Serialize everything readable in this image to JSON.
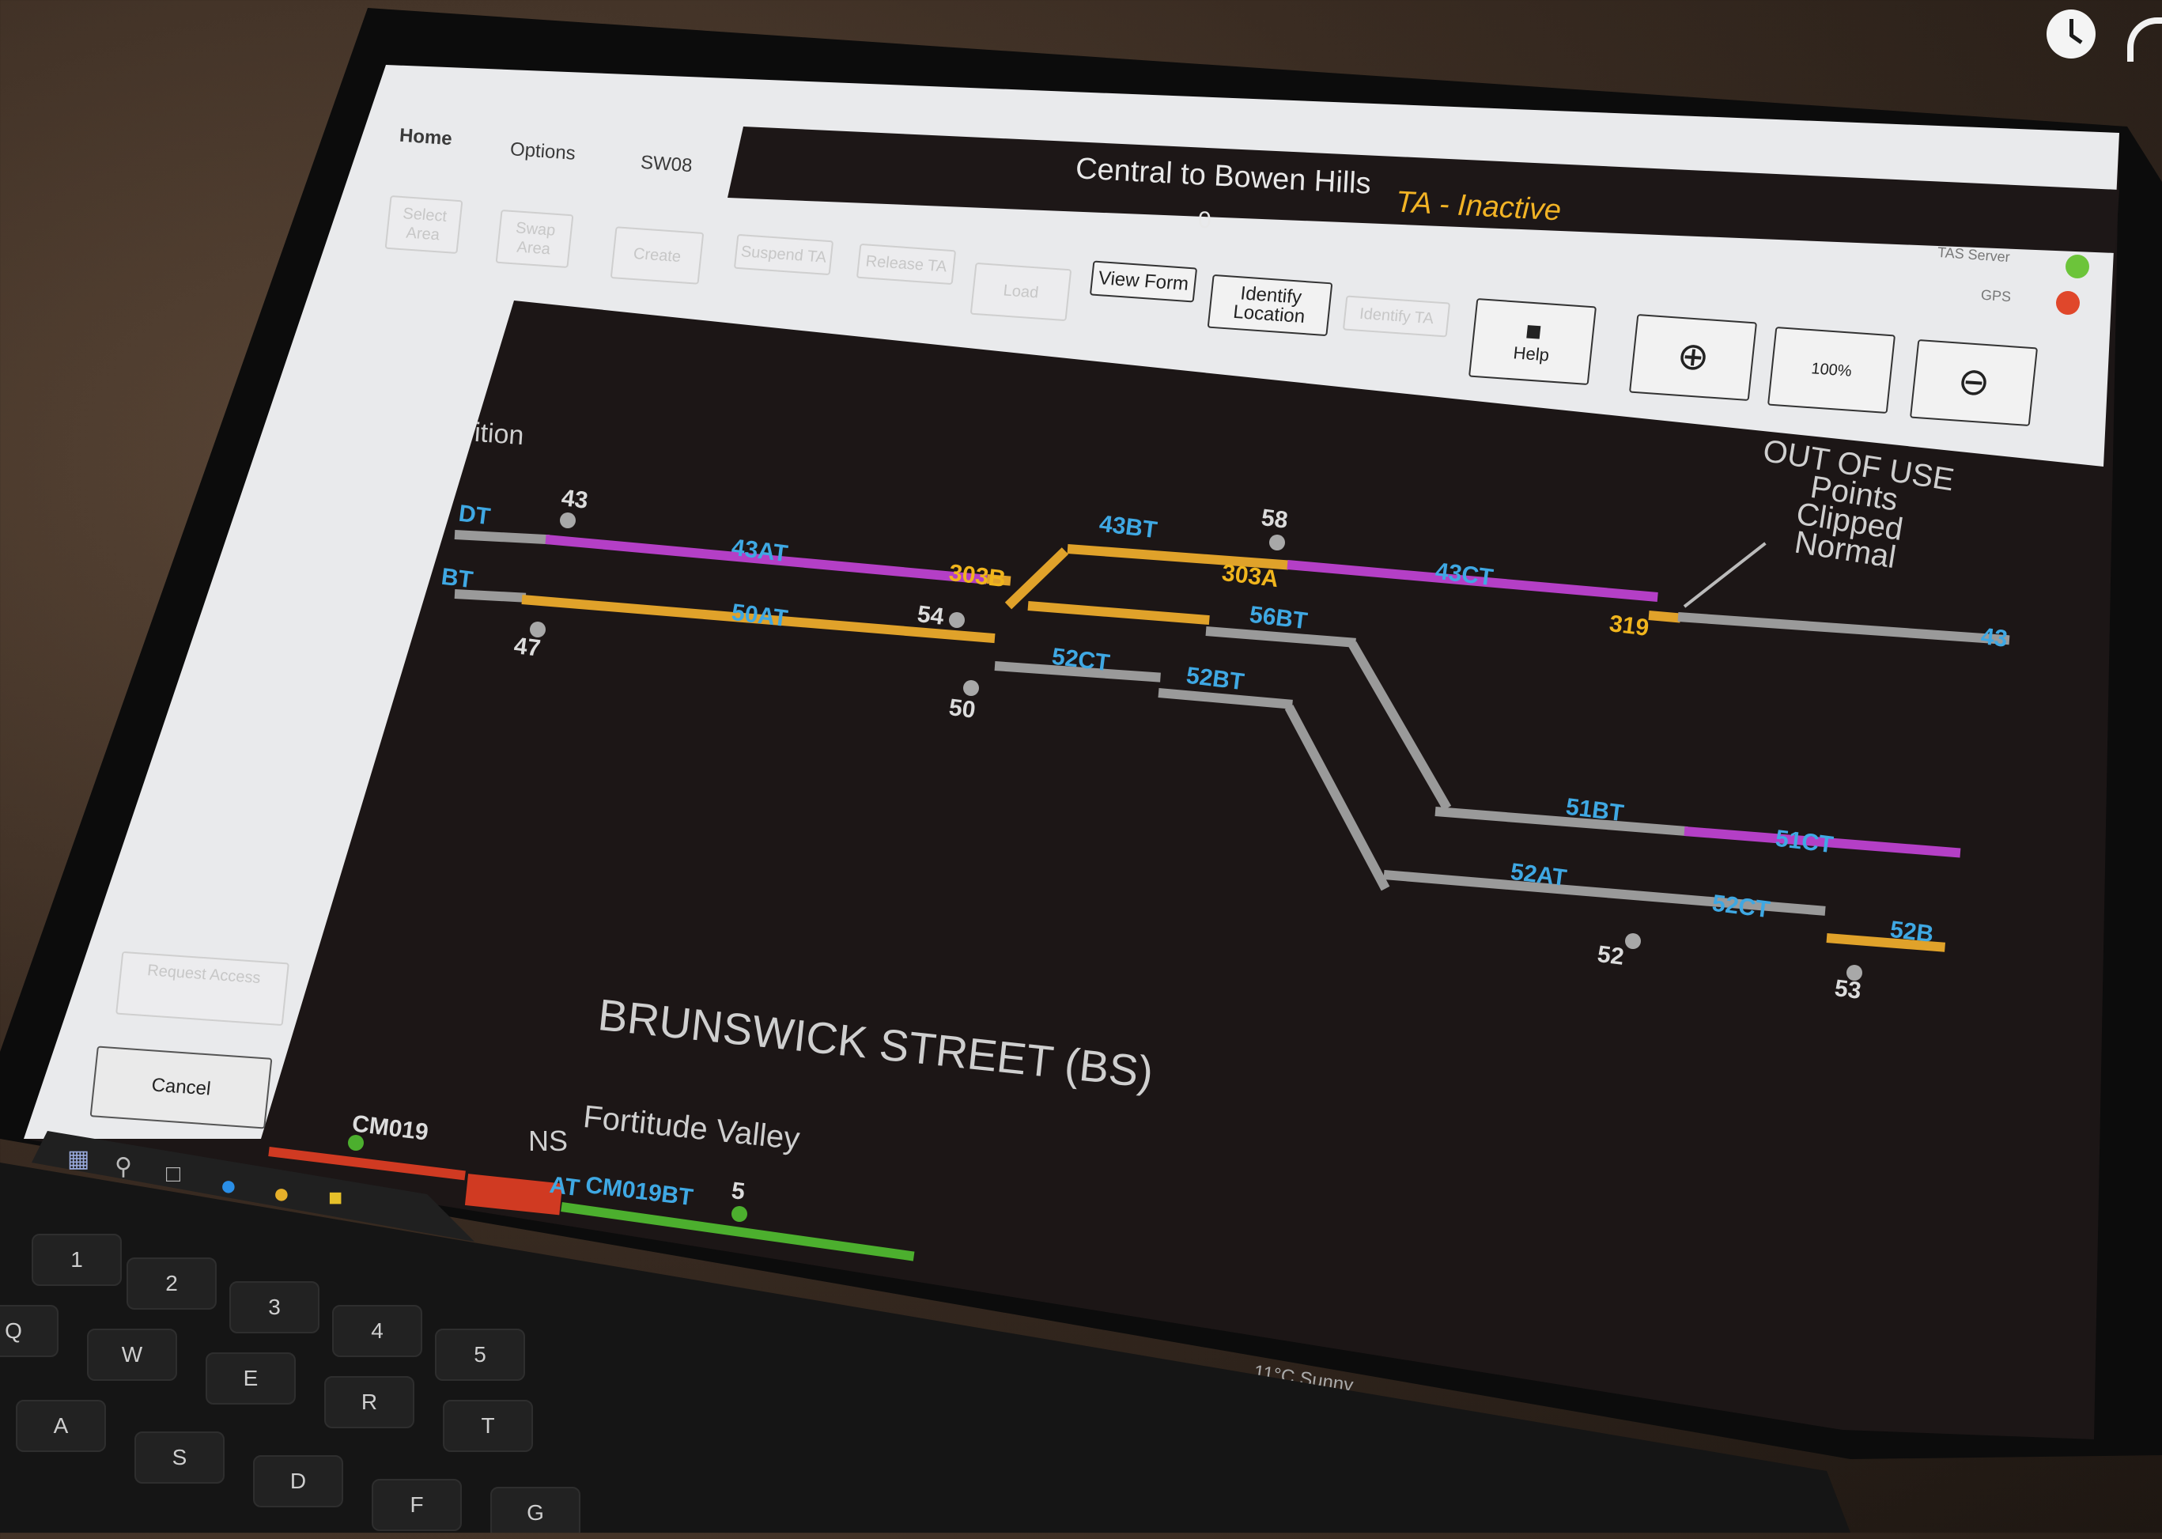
{
  "app": {
    "tabs": [
      "Home",
      "Options",
      "SW08"
    ],
    "title": "Central to Bowen Hills",
    "subtitle": "0",
    "status": "TA - Inactive",
    "indicators": [
      {
        "label": "TAS Server",
        "color": "#6cc43a"
      },
      {
        "label": "GPS",
        "color": "#e0472b"
      }
    ]
  },
  "toolbar": {
    "select_area": "Select Area",
    "swap_area": "Swap Area",
    "create": "Create",
    "suspend_ta": "Suspend TA",
    "release_ta": "Release TA",
    "load": "Load",
    "view_form": "View Form",
    "identify_location": "Identify Location",
    "identify_ta": "Identify TA",
    "help": "Help",
    "zoom_level": "100%"
  },
  "side_panel": {
    "request_access": "Request Access",
    "cancel": "Cancel",
    "partial_label": "ition"
  },
  "diagram": {
    "track_labels_cyan": [
      "43AT",
      "50AT",
      "43BT",
      "56BT",
      "43CT",
      "52CT",
      "52BT",
      "51BT",
      "51CT",
      "52AT",
      "52CT",
      "52B",
      "CM019BT"
    ],
    "track_labels_yellow": [
      "303B",
      "303A",
      "319"
    ],
    "signal_labels": [
      "43",
      "47",
      "54",
      "50",
      "58",
      "52",
      "53",
      "5"
    ],
    "edge_labels": [
      "DT",
      "BT",
      "43"
    ],
    "station": "BRUNSWICK STREET (BS)",
    "location": "Fortitude Valley",
    "ns": "NS",
    "cm": "CM019",
    "at_fragment": "AT",
    "out_of_use": [
      "OUT OF USE",
      "Points",
      "Clipped",
      "Normal"
    ],
    "colors": {
      "magenta": "#b43fc6",
      "yellow": "#e0a22a",
      "grey": "#9a9a9a",
      "green": "#4caf2e",
      "red": "#d03a22"
    }
  },
  "taskbar": {
    "weather": "11°C Sunny"
  },
  "keyboard": {
    "keys": [
      "1",
      "2",
      "3",
      "4",
      "5",
      "Q",
      "W",
      "E",
      "R",
      "T",
      "A",
      "S",
      "D",
      "F",
      "G"
    ]
  }
}
